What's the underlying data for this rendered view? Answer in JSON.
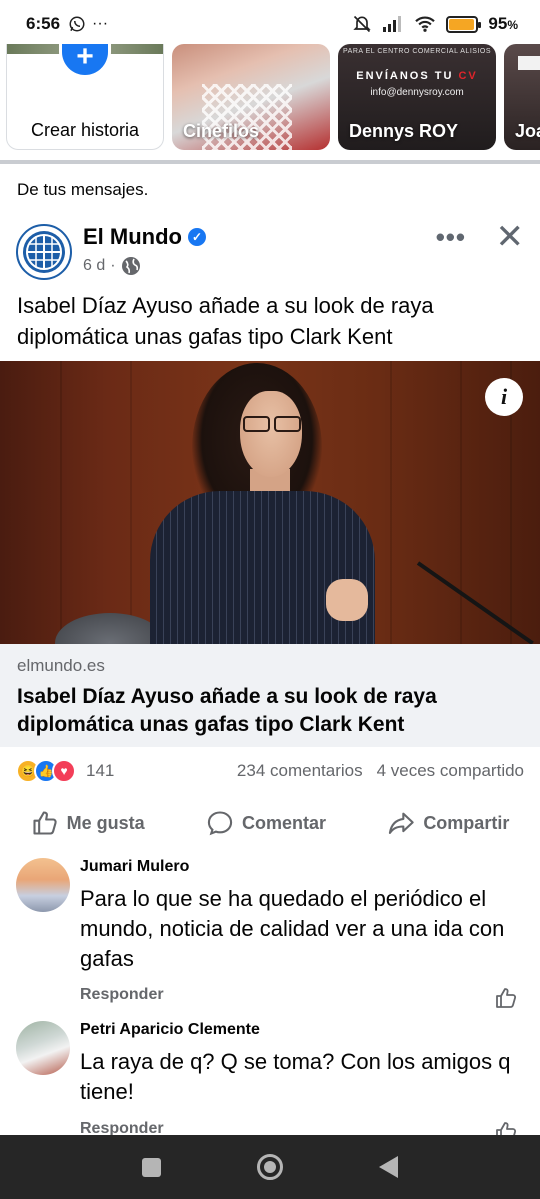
{
  "status_bar": {
    "time": "6:56",
    "battery_percent": "95",
    "battery_unit": "%",
    "battery_level": 0.95,
    "icons": [
      "whatsapp-icon",
      "more-dots-icon",
      "mute-icon",
      "signal-icon",
      "wifi-icon",
      "battery-icon"
    ]
  },
  "stories": {
    "create_label": "Crear historia",
    "items": [
      {
        "name": "Cinefilos"
      },
      {
        "name": "Dennys ROY",
        "tiny_text": "PARA EL CENTRO COMERCIAL ALISIOS",
        "headline_a": "ENVÍANOS TU ",
        "headline_b": "CV",
        "email": "info@dennysroy.com"
      },
      {
        "name": "Joa"
      }
    ]
  },
  "feed": {
    "section_label": "De tus mensajes."
  },
  "post": {
    "page_name": "El Mundo",
    "time_ago": "6 d",
    "separator": "·",
    "text": "Isabel Díaz Ayuso añade a su look de raya diplomática unas gafas tipo Clark Kent",
    "info_label": "i",
    "link": {
      "domain": "elmundo.es",
      "title": "Isabel Díaz Ayuso añade a su look de raya diplomática unas gafas tipo Clark Kent"
    },
    "reactions_count": "141",
    "comments_count": "234 comentarios",
    "shares_count": "4 veces compartido",
    "actions": {
      "like": "Me gusta",
      "comment": "Comentar",
      "share": "Compartir"
    }
  },
  "comments": [
    {
      "author": "Jumari Mulero",
      "text": "Para lo que se ha quedado el periódico el mundo, noticia de calidad ver a una ida con gafas",
      "reply_label": "Responder"
    },
    {
      "author": "Petri Aparicio Clemente",
      "text": "La raya de q? Q se toma? Con los amigos q tiene!",
      "reply_label": "Responder"
    }
  ],
  "colors": {
    "facebook_blue": "#1877f2",
    "secondary_text": "#65676b",
    "link_bg": "#f0f2f5",
    "navbar_bg": "#262626"
  }
}
